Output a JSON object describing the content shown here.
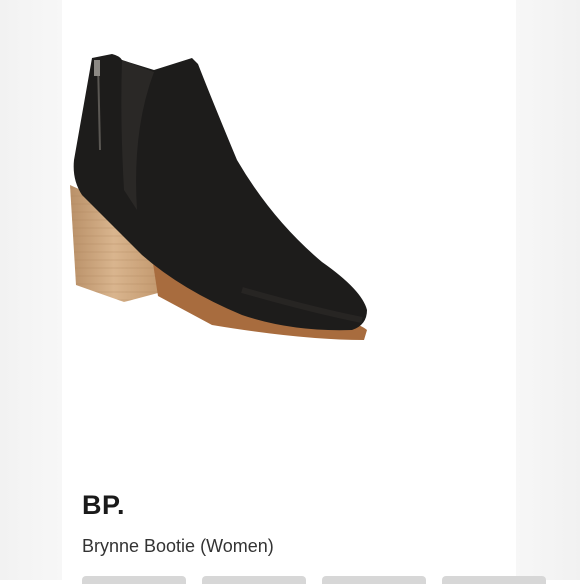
{
  "product": {
    "brand": "BP.",
    "name": "Brynne Bootie (Women)",
    "image_icon": "black-suede-ankle-boot"
  },
  "colors": {
    "background": "#ffffff",
    "boot": "#1d1c1b",
    "heel": "#caa37a",
    "text": "#1a1a1a"
  }
}
